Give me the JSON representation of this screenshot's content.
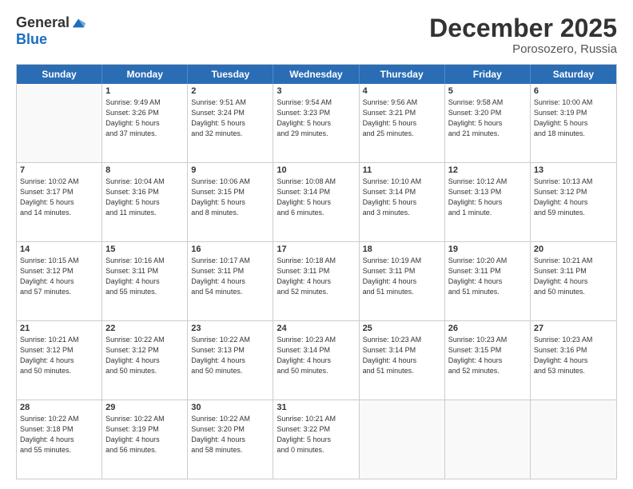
{
  "logo": {
    "general": "General",
    "blue": "Blue"
  },
  "header": {
    "month": "December 2025",
    "location": "Porosozero, Russia"
  },
  "weekdays": [
    "Sunday",
    "Monday",
    "Tuesday",
    "Wednesday",
    "Thursday",
    "Friday",
    "Saturday"
  ],
  "weeks": [
    [
      {
        "day": "",
        "info": ""
      },
      {
        "day": "1",
        "info": "Sunrise: 9:49 AM\nSunset: 3:26 PM\nDaylight: 5 hours\nand 37 minutes."
      },
      {
        "day": "2",
        "info": "Sunrise: 9:51 AM\nSunset: 3:24 PM\nDaylight: 5 hours\nand 32 minutes."
      },
      {
        "day": "3",
        "info": "Sunrise: 9:54 AM\nSunset: 3:23 PM\nDaylight: 5 hours\nand 29 minutes."
      },
      {
        "day": "4",
        "info": "Sunrise: 9:56 AM\nSunset: 3:21 PM\nDaylight: 5 hours\nand 25 minutes."
      },
      {
        "day": "5",
        "info": "Sunrise: 9:58 AM\nSunset: 3:20 PM\nDaylight: 5 hours\nand 21 minutes."
      },
      {
        "day": "6",
        "info": "Sunrise: 10:00 AM\nSunset: 3:19 PM\nDaylight: 5 hours\nand 18 minutes."
      }
    ],
    [
      {
        "day": "7",
        "info": "Sunrise: 10:02 AM\nSunset: 3:17 PM\nDaylight: 5 hours\nand 14 minutes."
      },
      {
        "day": "8",
        "info": "Sunrise: 10:04 AM\nSunset: 3:16 PM\nDaylight: 5 hours\nand 11 minutes."
      },
      {
        "day": "9",
        "info": "Sunrise: 10:06 AM\nSunset: 3:15 PM\nDaylight: 5 hours\nand 8 minutes."
      },
      {
        "day": "10",
        "info": "Sunrise: 10:08 AM\nSunset: 3:14 PM\nDaylight: 5 hours\nand 6 minutes."
      },
      {
        "day": "11",
        "info": "Sunrise: 10:10 AM\nSunset: 3:14 PM\nDaylight: 5 hours\nand 3 minutes."
      },
      {
        "day": "12",
        "info": "Sunrise: 10:12 AM\nSunset: 3:13 PM\nDaylight: 5 hours\nand 1 minute."
      },
      {
        "day": "13",
        "info": "Sunrise: 10:13 AM\nSunset: 3:12 PM\nDaylight: 4 hours\nand 59 minutes."
      }
    ],
    [
      {
        "day": "14",
        "info": "Sunrise: 10:15 AM\nSunset: 3:12 PM\nDaylight: 4 hours\nand 57 minutes."
      },
      {
        "day": "15",
        "info": "Sunrise: 10:16 AM\nSunset: 3:11 PM\nDaylight: 4 hours\nand 55 minutes."
      },
      {
        "day": "16",
        "info": "Sunrise: 10:17 AM\nSunset: 3:11 PM\nDaylight: 4 hours\nand 54 minutes."
      },
      {
        "day": "17",
        "info": "Sunrise: 10:18 AM\nSunset: 3:11 PM\nDaylight: 4 hours\nand 52 minutes."
      },
      {
        "day": "18",
        "info": "Sunrise: 10:19 AM\nSunset: 3:11 PM\nDaylight: 4 hours\nand 51 minutes."
      },
      {
        "day": "19",
        "info": "Sunrise: 10:20 AM\nSunset: 3:11 PM\nDaylight: 4 hours\nand 51 minutes."
      },
      {
        "day": "20",
        "info": "Sunrise: 10:21 AM\nSunset: 3:11 PM\nDaylight: 4 hours\nand 50 minutes."
      }
    ],
    [
      {
        "day": "21",
        "info": "Sunrise: 10:21 AM\nSunset: 3:12 PM\nDaylight: 4 hours\nand 50 minutes."
      },
      {
        "day": "22",
        "info": "Sunrise: 10:22 AM\nSunset: 3:12 PM\nDaylight: 4 hours\nand 50 minutes."
      },
      {
        "day": "23",
        "info": "Sunrise: 10:22 AM\nSunset: 3:13 PM\nDaylight: 4 hours\nand 50 minutes."
      },
      {
        "day": "24",
        "info": "Sunrise: 10:23 AM\nSunset: 3:14 PM\nDaylight: 4 hours\nand 50 minutes."
      },
      {
        "day": "25",
        "info": "Sunrise: 10:23 AM\nSunset: 3:14 PM\nDaylight: 4 hours\nand 51 minutes."
      },
      {
        "day": "26",
        "info": "Sunrise: 10:23 AM\nSunset: 3:15 PM\nDaylight: 4 hours\nand 52 minutes."
      },
      {
        "day": "27",
        "info": "Sunrise: 10:23 AM\nSunset: 3:16 PM\nDaylight: 4 hours\nand 53 minutes."
      }
    ],
    [
      {
        "day": "28",
        "info": "Sunrise: 10:22 AM\nSunset: 3:18 PM\nDaylight: 4 hours\nand 55 minutes."
      },
      {
        "day": "29",
        "info": "Sunrise: 10:22 AM\nSunset: 3:19 PM\nDaylight: 4 hours\nand 56 minutes."
      },
      {
        "day": "30",
        "info": "Sunrise: 10:22 AM\nSunset: 3:20 PM\nDaylight: 4 hours\nand 58 minutes."
      },
      {
        "day": "31",
        "info": "Sunrise: 10:21 AM\nSunset: 3:22 PM\nDaylight: 5 hours\nand 0 minutes."
      },
      {
        "day": "",
        "info": ""
      },
      {
        "day": "",
        "info": ""
      },
      {
        "day": "",
        "info": ""
      }
    ]
  ]
}
